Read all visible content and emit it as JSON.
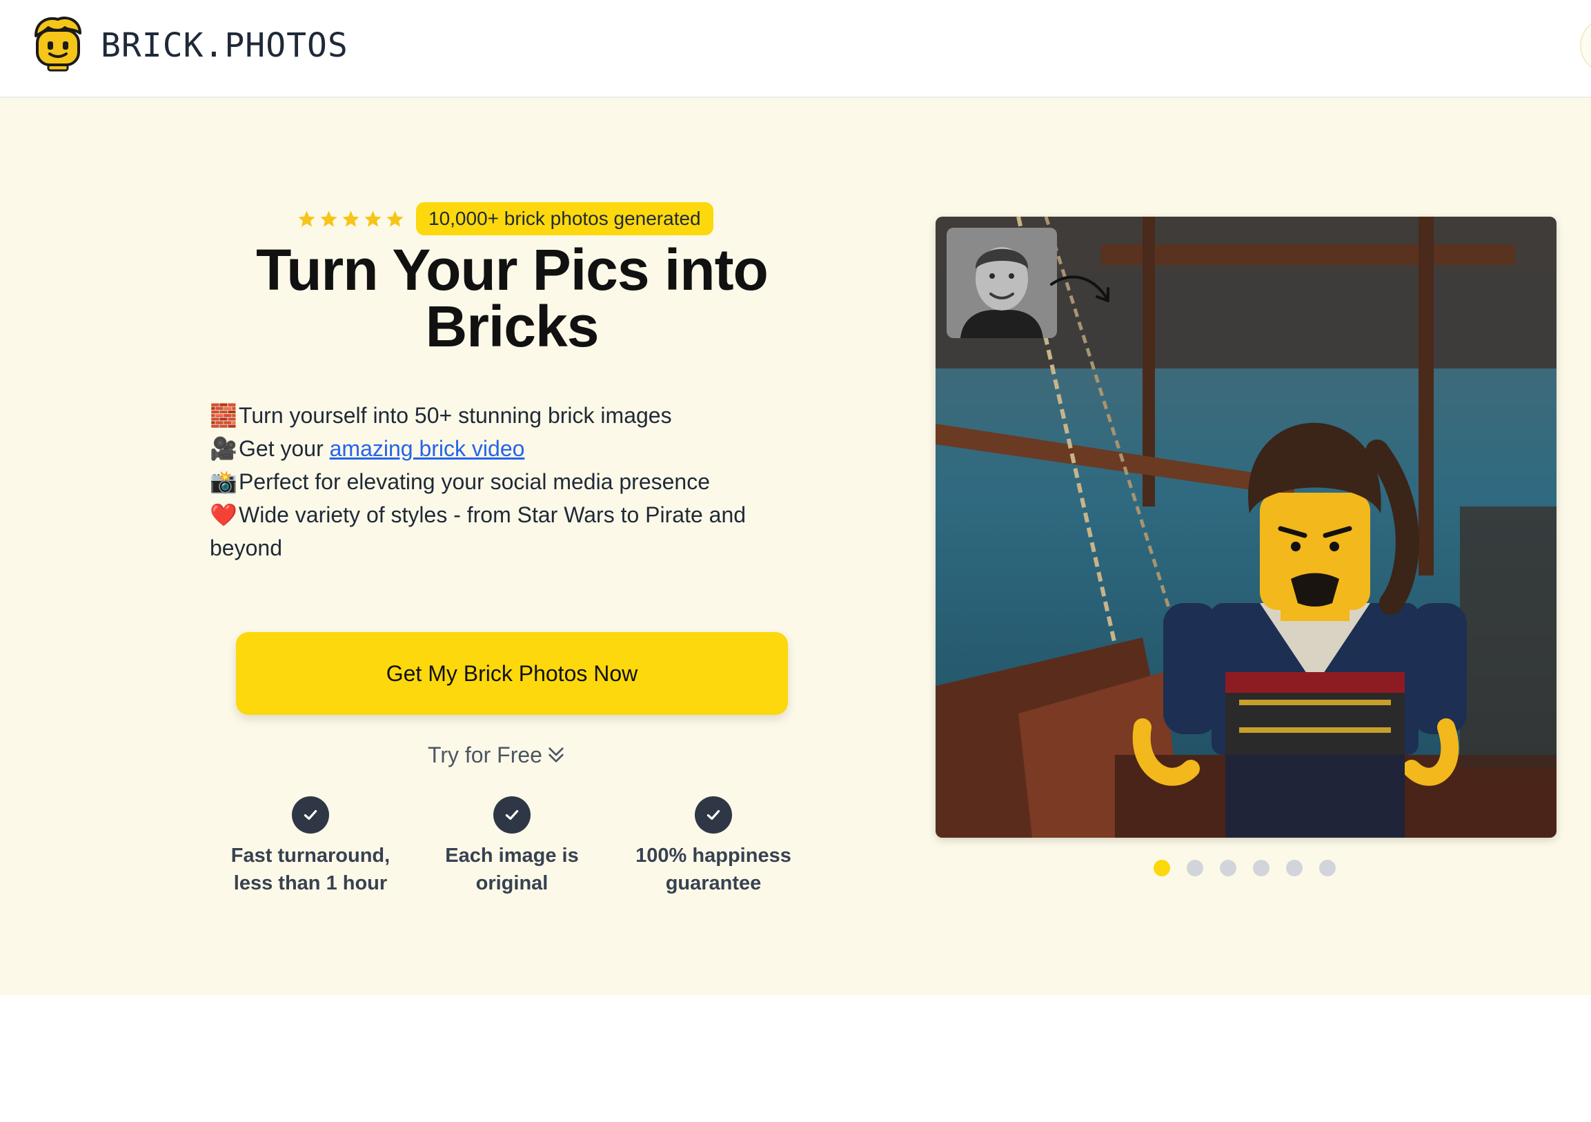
{
  "header": {
    "brand": "BRICK.PHOTOS",
    "logo_icon": "brick-figure-head-icon"
  },
  "hero": {
    "rating_stars": 5,
    "badge": "10,000+ brick photos generated",
    "headline_line1": "Turn Your Pics into",
    "headline_line2": "Bricks",
    "features": [
      {
        "emoji": "🧱",
        "text": "Turn yourself into 50+ stunning brick images"
      },
      {
        "emoji": "🎥",
        "text_before": "Get your ",
        "link_text": "amazing brick video"
      },
      {
        "emoji": "📸",
        "text": "Perfect for elevating your social media presence"
      },
      {
        "emoji": "❤️",
        "text": "Wide variety of styles - from Star Wars to Pirate and beyond"
      }
    ],
    "cta": "Get My Brick Photos Now",
    "try_free": "Try for Free",
    "guarantees": [
      {
        "line1": "Fast turnaround,",
        "line2": "less than 1 hour"
      },
      {
        "line1": "Each image is",
        "line2": "original"
      },
      {
        "line1": "100% happiness",
        "line2": "guarantee"
      }
    ]
  },
  "carousel": {
    "slide_count": 6,
    "active_index": 0
  },
  "colors": {
    "accent": "#fcd80c",
    "hero_background": "#fcf9e8",
    "link": "#2563eb",
    "check_badge": "#2f3747"
  }
}
